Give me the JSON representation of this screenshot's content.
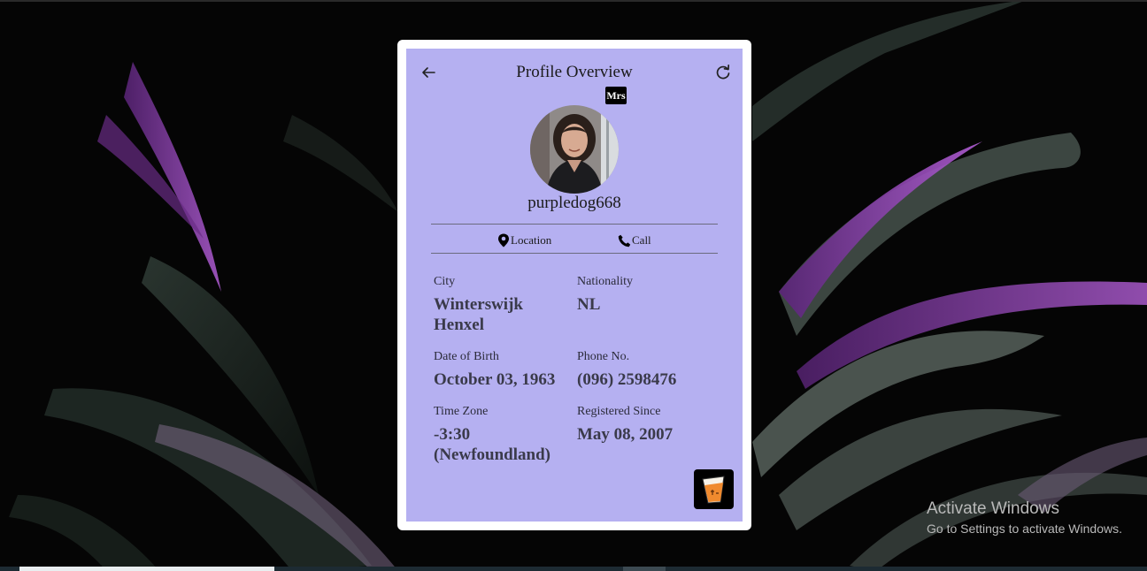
{
  "header": {
    "title": "Profile Overview"
  },
  "icons": {
    "back": "arrow-left-icon",
    "refresh": "refresh-icon",
    "location": "map-pin-icon",
    "call": "phone-icon",
    "logo": "cup-logo-icon"
  },
  "profile": {
    "title_badge": "Mrs",
    "username": "purpledog668"
  },
  "actions": {
    "location_label": "Location",
    "call_label": "Call"
  },
  "details": [
    {
      "label": "City",
      "value": "Winterswijk Henxel"
    },
    {
      "label": "Nationality",
      "value": "NL"
    },
    {
      "label": "Date of Birth",
      "value": "October 03, 1963"
    },
    {
      "label": "Phone No.",
      "value": "(096) 2598476"
    },
    {
      "label": "Time Zone",
      "value": "-3:30 (Newfoundland)"
    },
    {
      "label": "Registered Since",
      "value": "May 08, 2007"
    }
  ],
  "watermark": {
    "line1": "Activate Windows",
    "line2": "Go to Settings to activate Windows."
  },
  "colors": {
    "card_bg": "#b5b0f1",
    "page_bg": "#050505",
    "leaf_purple": "#8a3fb0"
  }
}
